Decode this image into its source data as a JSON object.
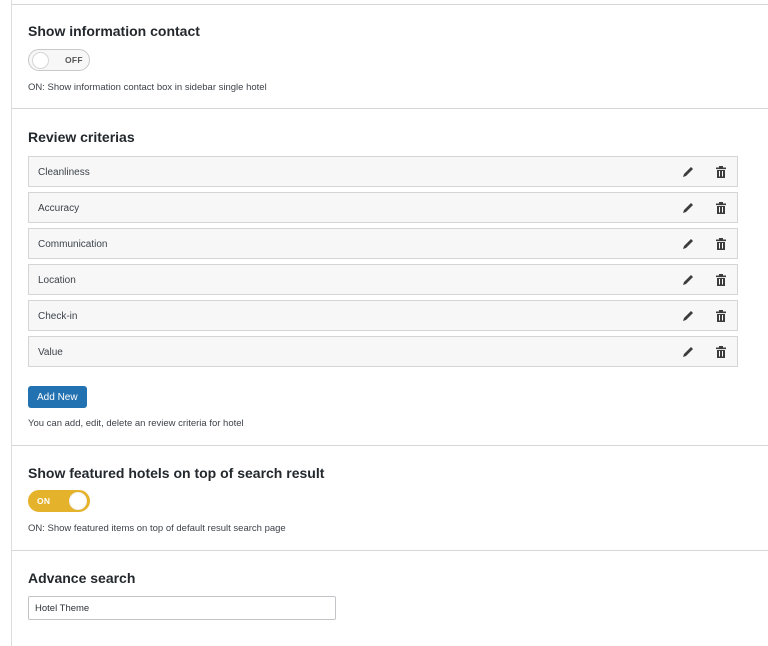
{
  "contact": {
    "title": "Show information contact",
    "toggle_label": "OFF",
    "description": "ON: Show information contact box in sidebar single hotel"
  },
  "criteria": {
    "title": "Review criterias",
    "items": [
      {
        "label": "Cleanliness"
      },
      {
        "label": "Accuracy"
      },
      {
        "label": "Communication"
      },
      {
        "label": "Location"
      },
      {
        "label": "Check-in"
      },
      {
        "label": "Value"
      }
    ],
    "add_label": "Add New",
    "description": "You can add, edit, delete an review criteria for hotel",
    "edit_icon": "pencil-icon",
    "delete_icon": "trash-icon"
  },
  "featured": {
    "title": "Show featured hotels on top of search result",
    "toggle_label": "ON",
    "toggle_color": "#e5b22b",
    "description": "ON: Show featured items on top of default result search page"
  },
  "advance": {
    "title": "Advance search",
    "input_value": "Hotel Theme"
  },
  "colors": {
    "primary_button": "#2271b1",
    "toggle_on": "#e5b22b"
  }
}
